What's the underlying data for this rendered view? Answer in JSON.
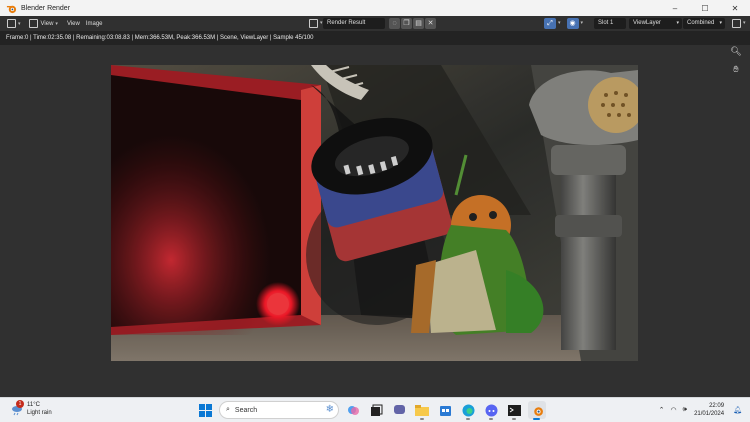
{
  "window": {
    "title": "Blender Render",
    "controls": [
      "–",
      "☐",
      "✕"
    ]
  },
  "header": {
    "view_label": "View",
    "view2_label": "View",
    "image_label": "Image",
    "render_name": "Render Result",
    "slot": "Slot 1",
    "view_layer": "ViewLayer",
    "pass": "Combined"
  },
  "status": {
    "text": "Frame:0 | Time:02:35.08 | Remaining:03:08.83 | Mem:366.53M, Peak:366.53M | Scene, ViewLayer | Sample 45/100"
  },
  "colors": {
    "accent": "#4772b3",
    "taskbar_bg": "#eef0f3",
    "render_red": "#c8202a"
  },
  "taskbar": {
    "weather_temp": "11°C",
    "weather_desc": "Light rain",
    "weather_badge": "1",
    "search_placeholder": "Search",
    "time": "22:09",
    "date": "21/01/2024",
    "apps": [
      "windows-start-icon",
      "search-icon",
      "copilot-icon",
      "terminal-app-icon",
      "chat-app-icon",
      "file-explorer-icon",
      "store-icon",
      "edge-icon",
      "discord-icon",
      "command-prompt-icon",
      "blender-icon"
    ]
  }
}
